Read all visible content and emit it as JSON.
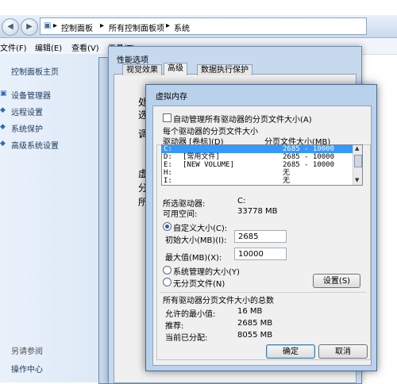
{
  "address": {
    "segments": [
      "控制面板",
      "所有控制面板项",
      "系统"
    ]
  },
  "menu": [
    "文件(F)",
    "编辑(E)",
    "查看(V)",
    "工具(T)"
  ],
  "sidebar": {
    "home": "控制面板主页",
    "items": [
      {
        "label": "设备管理器",
        "icon": "device-icon"
      },
      {
        "label": "远程设置",
        "icon": "shield-icon"
      },
      {
        "label": "系统保护",
        "icon": "shield-icon"
      },
      {
        "label": "高级系统设置",
        "icon": "shield-icon"
      }
    ],
    "see_also": "另请参阅",
    "action_center": "操作中心"
  },
  "props_window": {
    "title": "性能选项",
    "tabs": [
      "视觉效果",
      "高级",
      "数据执行保护"
    ],
    "partial_text": [
      "处",
      "选",
      "调",
      "虚",
      "分",
      "所"
    ]
  },
  "vm_dialog": {
    "title": "虚拟内存",
    "auto_manage": "自动管理所有驱动器的分页文件大小(A)",
    "group_title": "每个驱动器的分页文件大小",
    "col_drive": "驱动器 [卷标](D)",
    "col_size": "分页文件大小(MB)",
    "drives": [
      {
        "drive": "C:",
        "label": "",
        "size": "2685 - 10000",
        "selected": true
      },
      {
        "drive": "D:",
        "label": "[常用文件]",
        "size": "2685 - 10000",
        "selected": false
      },
      {
        "drive": "E:",
        "label": "[NEW VOLUME]",
        "size": "2685 - 10000",
        "selected": false
      },
      {
        "drive": "H:",
        "label": "",
        "size": "无",
        "selected": false
      },
      {
        "drive": "I:",
        "label": "",
        "size": "无",
        "selected": false
      }
    ],
    "selected_drive_label": "所选驱动器:",
    "selected_drive_value": "C:",
    "free_space_label": "可用空间:",
    "free_space_value": "33778 MB",
    "custom_size": "自定义大小(C):",
    "initial_size_label": "初始大小(MB)(I):",
    "initial_size_value": "2685",
    "max_size_label": "最大值(MB)(X):",
    "max_size_value": "10000",
    "system_managed": "系统管理的大小(Y)",
    "no_paging": "无分页文件(N)",
    "set_button": "设置(S)",
    "total_title": "所有驱动器分页文件大小的总数",
    "min_allowed_label": "允许的最小值:",
    "min_allowed_value": "16 MB",
    "recommended_label": "推荐:",
    "recommended_value": "2685 MB",
    "current_label": "当前已分配:",
    "current_value": "8055 MB",
    "ok_button": "确定",
    "cancel_button": "取消"
  }
}
